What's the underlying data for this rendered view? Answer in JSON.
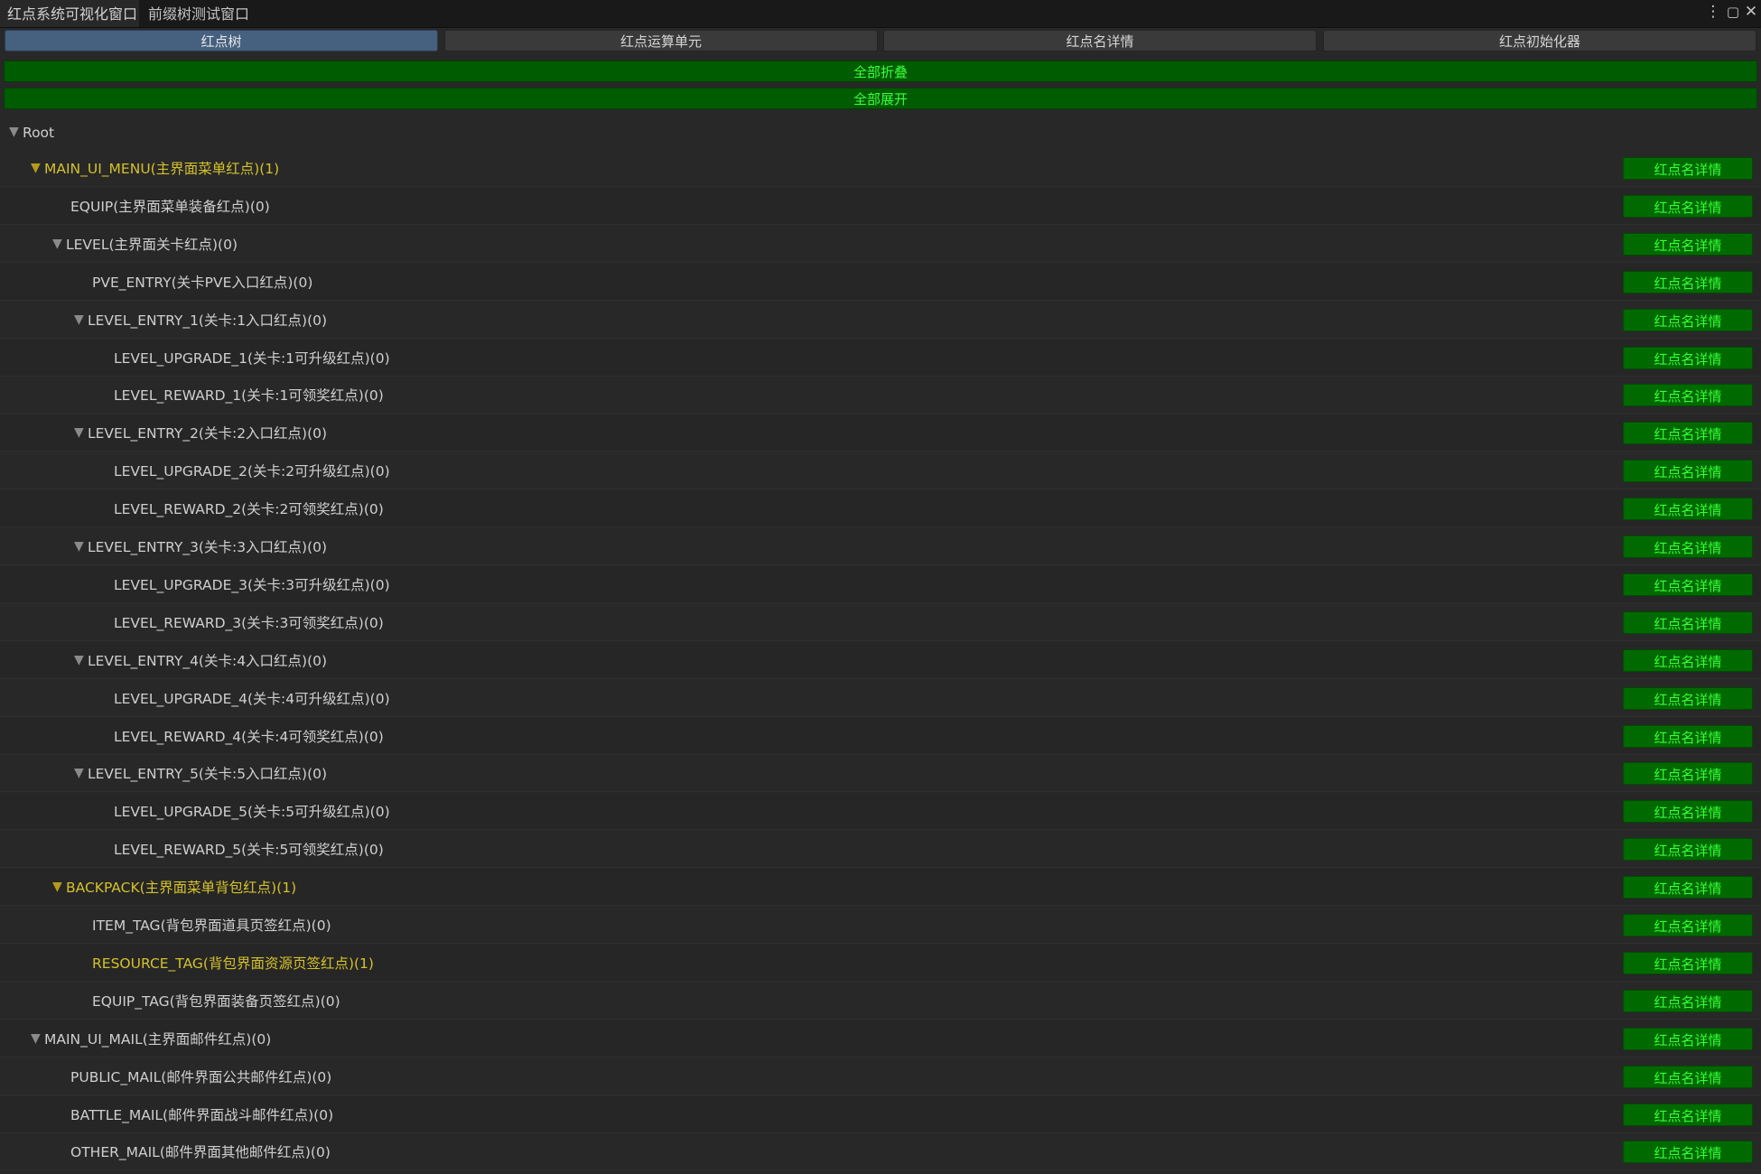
{
  "window_tabs": [
    {
      "label": "红点系统可视化窗口",
      "active": true
    },
    {
      "label": "前缀树测试窗口",
      "active": false
    }
  ],
  "window_controls": {
    "menu_icon": "⋮",
    "maximize_icon": "▢",
    "close_icon": "✕"
  },
  "toolbar": {
    "tabs": [
      {
        "label": "红点树",
        "active": true
      },
      {
        "label": "红点运算单元",
        "active": false
      },
      {
        "label": "红点名详情",
        "active": false
      },
      {
        "label": "红点初始化器",
        "active": false
      }
    ]
  },
  "actions": {
    "collapse_all": "全部折叠",
    "expand_all": "全部展开"
  },
  "tree": {
    "root_label": "Root",
    "detail_button_label": "红点名详情",
    "nodes": [
      {
        "label": "MAIN_UI_MENU(主界面菜单红点)(1)",
        "depth": 1,
        "has_children": true,
        "highlighted": true
      },
      {
        "label": "EQUIP(主界面菜单装备红点)(0)",
        "depth": 2,
        "has_children": false,
        "highlighted": false
      },
      {
        "label": "LEVEL(主界面关卡红点)(0)",
        "depth": 2,
        "has_children": true,
        "highlighted": false
      },
      {
        "label": "PVE_ENTRY(关卡PVE入口红点)(0)",
        "depth": 3,
        "has_children": false,
        "highlighted": false
      },
      {
        "label": "LEVEL_ENTRY_1(关卡:1入口红点)(0)",
        "depth": 3,
        "has_children": true,
        "highlighted": false
      },
      {
        "label": "LEVEL_UPGRADE_1(关卡:1可升级红点)(0)",
        "depth": 4,
        "has_children": false,
        "highlighted": false
      },
      {
        "label": "LEVEL_REWARD_1(关卡:1可领奖红点)(0)",
        "depth": 4,
        "has_children": false,
        "highlighted": false
      },
      {
        "label": "LEVEL_ENTRY_2(关卡:2入口红点)(0)",
        "depth": 3,
        "has_children": true,
        "highlighted": false
      },
      {
        "label": "LEVEL_UPGRADE_2(关卡:2可升级红点)(0)",
        "depth": 4,
        "has_children": false,
        "highlighted": false
      },
      {
        "label": "LEVEL_REWARD_2(关卡:2可领奖红点)(0)",
        "depth": 4,
        "has_children": false,
        "highlighted": false
      },
      {
        "label": "LEVEL_ENTRY_3(关卡:3入口红点)(0)",
        "depth": 3,
        "has_children": true,
        "highlighted": false
      },
      {
        "label": "LEVEL_UPGRADE_3(关卡:3可升级红点)(0)",
        "depth": 4,
        "has_children": false,
        "highlighted": false
      },
      {
        "label": "LEVEL_REWARD_3(关卡:3可领奖红点)(0)",
        "depth": 4,
        "has_children": false,
        "highlighted": false
      },
      {
        "label": "LEVEL_ENTRY_4(关卡:4入口红点)(0)",
        "depth": 3,
        "has_children": true,
        "highlighted": false
      },
      {
        "label": "LEVEL_UPGRADE_4(关卡:4可升级红点)(0)",
        "depth": 4,
        "has_children": false,
        "highlighted": false
      },
      {
        "label": "LEVEL_REWARD_4(关卡:4可领奖红点)(0)",
        "depth": 4,
        "has_children": false,
        "highlighted": false
      },
      {
        "label": "LEVEL_ENTRY_5(关卡:5入口红点)(0)",
        "depth": 3,
        "has_children": true,
        "highlighted": false
      },
      {
        "label": "LEVEL_UPGRADE_5(关卡:5可升级红点)(0)",
        "depth": 4,
        "has_children": false,
        "highlighted": false
      },
      {
        "label": "LEVEL_REWARD_5(关卡:5可领奖红点)(0)",
        "depth": 4,
        "has_children": false,
        "highlighted": false
      },
      {
        "label": "BACKPACK(主界面菜单背包红点)(1)",
        "depth": 2,
        "has_children": true,
        "highlighted": true
      },
      {
        "label": "ITEM_TAG(背包界面道具页签红点)(0)",
        "depth": 3,
        "has_children": false,
        "highlighted": false
      },
      {
        "label": "RESOURCE_TAG(背包界面资源页签红点)(1)",
        "depth": 3,
        "has_children": false,
        "highlighted": true
      },
      {
        "label": "EQUIP_TAG(背包界面装备页签红点)(0)",
        "depth": 3,
        "has_children": false,
        "highlighted": false
      },
      {
        "label": "MAIN_UI_MAIL(主界面邮件红点)(0)",
        "depth": 1,
        "has_children": true,
        "highlighted": false
      },
      {
        "label": "PUBLIC_MAIL(邮件界面公共邮件红点)(0)",
        "depth": 2,
        "has_children": false,
        "highlighted": false
      },
      {
        "label": "BATTLE_MAIL(邮件界面战斗邮件红点)(0)",
        "depth": 2,
        "has_children": false,
        "highlighted": false
      },
      {
        "label": "OTHER_MAIL(邮件界面其他邮件红点)(0)",
        "depth": 2,
        "has_children": false,
        "highlighted": false
      }
    ]
  },
  "colors": {
    "background": "#282828",
    "active_tab": "#46607f",
    "action_bar": "#005c00",
    "action_text": "#3cff3c",
    "detail_button": "#006a00",
    "highlight_text": "#d4c12a"
  },
  "icons": {
    "expanded_arrow": "▼"
  }
}
